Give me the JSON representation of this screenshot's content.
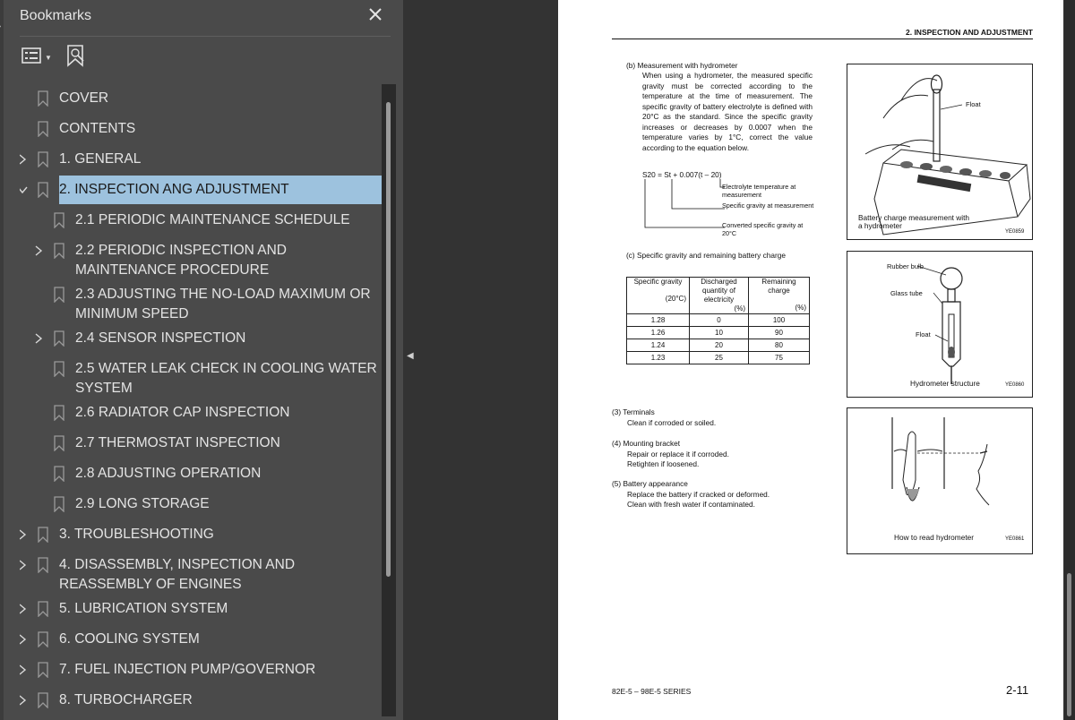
{
  "bookmarks_panel": {
    "title": "Bookmarks",
    "close_icon": "close-icon",
    "toolbar": {
      "options_icon": "options-list-icon",
      "add_icon": "add-bookmark-icon"
    },
    "items": [
      {
        "label": "COVER",
        "level": 0,
        "expandable": false,
        "expanded": false,
        "selected": false
      },
      {
        "label": "CONTENTS",
        "level": 0,
        "expandable": false,
        "expanded": false,
        "selected": false
      },
      {
        "label": "1. GENERAL",
        "level": 0,
        "expandable": true,
        "expanded": false,
        "selected": false
      },
      {
        "label": "2. INSPECTION ANG ADJUSTMENT",
        "level": 0,
        "expandable": true,
        "expanded": true,
        "selected": true
      },
      {
        "label": "2.1 PERIODIC MAINTENANCE SCHEDULE",
        "level": 1,
        "expandable": false,
        "expanded": false,
        "selected": false
      },
      {
        "label": "2.2 PERIODIC INSPECTION AND MAINTENANCE PROCEDURE",
        "level": 1,
        "expandable": true,
        "expanded": false,
        "selected": false
      },
      {
        "label": "2.3 ADJUSTING THE NO-LOAD MAXIMUM OR MINIMUM SPEED",
        "level": 1,
        "expandable": false,
        "expanded": false,
        "selected": false
      },
      {
        "label": "2.4 SENSOR INSPECTION",
        "level": 1,
        "expandable": true,
        "expanded": false,
        "selected": false
      },
      {
        "label": "2.5 WATER LEAK CHECK IN COOLING WATER SYSTEM",
        "level": 1,
        "expandable": false,
        "expanded": false,
        "selected": false
      },
      {
        "label": "2.6 RADIATOR CAP INSPECTION",
        "level": 1,
        "expandable": false,
        "expanded": false,
        "selected": false
      },
      {
        "label": "2.7 THERMOSTAT INSPECTION",
        "level": 1,
        "expandable": false,
        "expanded": false,
        "selected": false
      },
      {
        "label": "2.8 ADJUSTING OPERATION",
        "level": 1,
        "expandable": false,
        "expanded": false,
        "selected": false
      },
      {
        "label": "2.9 LONG STORAGE",
        "level": 1,
        "expandable": false,
        "expanded": false,
        "selected": false
      },
      {
        "label": "3. TROUBLESHOOTING",
        "level": 0,
        "expandable": true,
        "expanded": false,
        "selected": false
      },
      {
        "label": "4. DISASSEMBLY, INSPECTION AND REASSEMBLY OF ENGINES",
        "level": 0,
        "expandable": true,
        "expanded": false,
        "selected": false
      },
      {
        "label": "5. LUBRICATION SYSTEM",
        "level": 0,
        "expandable": true,
        "expanded": false,
        "selected": false
      },
      {
        "label": "6. COOLING SYSTEM",
        "level": 0,
        "expandable": true,
        "expanded": false,
        "selected": false
      },
      {
        "label": "7. FUEL INJECTION PUMP/GOVERNOR",
        "level": 0,
        "expandable": true,
        "expanded": false,
        "selected": false
      },
      {
        "label": "8. TURBOCHARGER",
        "level": 0,
        "expandable": true,
        "expanded": false,
        "selected": false
      }
    ]
  },
  "colors": {
    "panel_bg": "#4a4a4a",
    "viewer_bg": "#333333",
    "selection_bg": "#9dc2de",
    "page_bg": "#ffffff"
  },
  "document": {
    "header": "2. INSPECTION AND ADJUSTMENT",
    "section_b": {
      "heading": "(b)  Measurement with hydrometer",
      "body": "When using a hydrometer, the measured specific gravity must be corrected according to the temperature at the time of measurement.  The specific gravity of battery electrolyte is defined with 20°C as the standard. Since the specific gravity increases or decreases by 0.0007 when the temperature varies by 1°C, correct the value according to the equation below.",
      "formula": "S20 = St + 0.007(t – 20)",
      "label_temp": "Electrolyte temperature at measurement",
      "label_sg": "Specific gravity at measurement",
      "label_converted": "Converted specific gravity at 20°C"
    },
    "section_c": {
      "heading": "(c)  Specific gravity and remaining battery charge",
      "table": {
        "headers": [
          "Specific gravity",
          "Discharged quantity of electricity",
          "Remaining charge"
        ],
        "units": [
          "(20°C)",
          "(%)",
          "(%)"
        ],
        "rows": [
          [
            "1.28",
            "0",
            "100"
          ],
          [
            "1.26",
            "10",
            "90"
          ],
          [
            "1.24",
            "20",
            "80"
          ],
          [
            "1.23",
            "25",
            "75"
          ]
        ]
      }
    },
    "items": [
      {
        "heading": "(3)  Terminals",
        "lines": [
          "Clean if corroded or soiled."
        ]
      },
      {
        "heading": "(4)  Mounting bracket",
        "lines": [
          "Repair or replace it if corroded.",
          "Retighten if loosened."
        ]
      },
      {
        "heading": "(5)  Battery appearance",
        "lines": [
          "Replace the battery if cracked or deformed.",
          "Clean with fresh water if contaminated."
        ]
      }
    ],
    "figures": {
      "fig1": {
        "label_float": "Float",
        "caption": "Battery charge measurement with a hydrometer",
        "code": "YE0859"
      },
      "fig2": {
        "label_bulb": "Rubber bulb",
        "label_tube": "Glass tube",
        "label_float": "Float",
        "caption": "Hydrometer structure",
        "code": "YE0860"
      },
      "fig3": {
        "caption": "How to read hydrometer",
        "code": "YE0861"
      }
    },
    "footer_left": "82E-5 – 98E-5 SERIES",
    "footer_right": "2-11"
  }
}
